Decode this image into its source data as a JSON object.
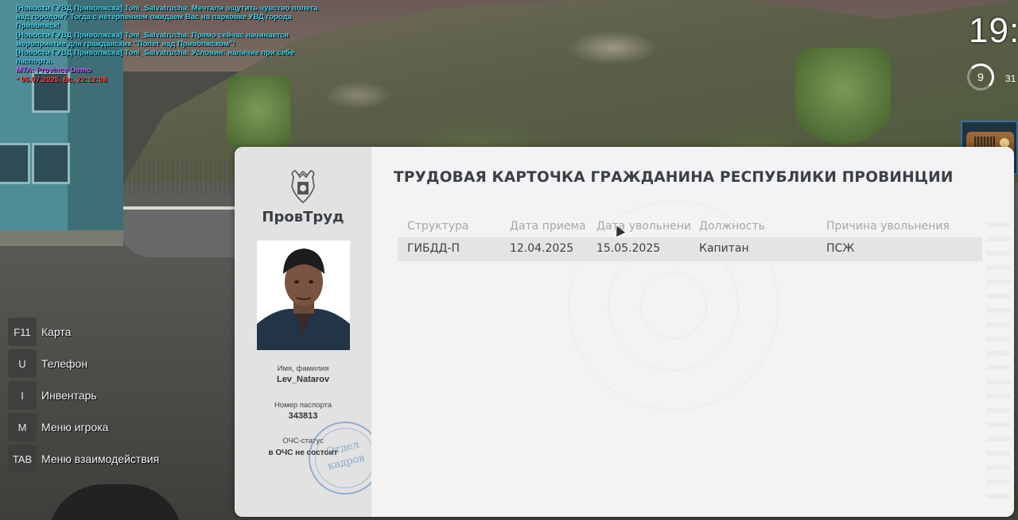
{
  "chat": {
    "lines": [
      {
        "text": "[Новости ГУВД Приволжска] Toni_Salvatrucha: Мечтали ощутить чувство полета над городом? Тогда с нетерпением ожидаем Вас на парковке УВД города Приволжск!",
        "kind": "news"
      },
      {
        "text": "[Новости ГУВД Приволжска] Toni_Salvatrucha: Прямо сейчас начинается мероприятие для гражданских \"Полет над Приволжском\"!",
        "kind": "news"
      },
      {
        "text": "[Новости ГУВД Приволжска] Toni_Salvatrucha: Условия: наличие при себе паспорта.",
        "kind": "news"
      },
      {
        "text": "MTA: Province Demo",
        "kind": "mta"
      },
      {
        "text": "* 06.07.2025, Вс, 22:12:08",
        "kind": "date"
      }
    ]
  },
  "hud": {
    "clock": "19:",
    "ring_value": "9",
    "ring_side": "31"
  },
  "keys": [
    {
      "key": "F11",
      "label": "Карта",
      "name": "map"
    },
    {
      "key": "U",
      "label": "Телефон",
      "name": "phone"
    },
    {
      "key": "I",
      "label": "Инвентарь",
      "name": "inventory"
    },
    {
      "key": "M",
      "label": "Меню игрока",
      "name": "player-menu"
    },
    {
      "key": "TAB",
      "label": "Меню взаимодействия",
      "name": "interaction-menu"
    }
  ],
  "card": {
    "brand": "ПровТруд",
    "title": "ТРУДОВАЯ КАРТОЧКА ГРАЖДАНИНА РЕСПУБЛИКИ ПРОВИНЦИИ",
    "name_label": "Имя, фамилия",
    "name_value": "Lev_Natarov",
    "passport_label": "Номер паспорта",
    "passport_value": "343813",
    "ochs_label": "ОЧС-статус",
    "ochs_value": "в ОЧС не состоит",
    "stamp_line1": "Отдел",
    "stamp_line2": "кадров",
    "columns": [
      "Структура",
      "Дата приема",
      "Дата увольнени",
      "Должность",
      "Причина увольнения"
    ],
    "rows": [
      [
        "ГИБДД-П",
        "12.04.2025",
        "15.05.2025",
        "Капитан",
        "ПСЖ"
      ]
    ]
  },
  "colors": {
    "chat_news": "#41d1e8",
    "chat_mta": "#c85cff",
    "chat_date": "#ff4a4a",
    "card_bg": "#f1f1f1",
    "stamp": "#5082be"
  }
}
